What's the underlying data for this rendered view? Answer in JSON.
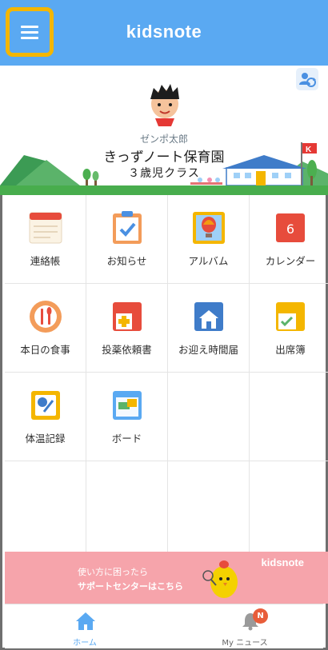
{
  "header": {
    "brand": "kidsnote",
    "color": "#5aa9f2",
    "menu_icon": "hamburger-menu-icon",
    "highlight": "#f4b600"
  },
  "profile": {
    "user_name": "ゼンポ太郎",
    "school": "きっずノート保育園",
    "class": "３歳児クラス",
    "switch_icon": "switch-account-icon"
  },
  "menu": {
    "items": [
      {
        "label": "連絡帳",
        "icon": "notebook-icon"
      },
      {
        "label": "お知らせ",
        "icon": "notice-clipboard-icon"
      },
      {
        "label": "アルバム",
        "icon": "album-balloon-icon"
      },
      {
        "label": "カレンダー",
        "icon": "calendar-icon",
        "value": "6"
      },
      {
        "label": "本日の食事",
        "icon": "meal-icon"
      },
      {
        "label": "投薬依頼書",
        "icon": "medicine-request-icon"
      },
      {
        "label": "お迎え時間届",
        "icon": "pickup-house-icon"
      },
      {
        "label": "出席簿",
        "icon": "attendance-icon"
      },
      {
        "label": "体温記録",
        "icon": "thermometer-icon"
      },
      {
        "label": "ボード",
        "icon": "board-icon"
      }
    ]
  },
  "banner": {
    "line1": "使い方に困ったら",
    "line2": "サポートセンターはこちら",
    "brand": "kidsnote",
    "color": "#f6a4ab"
  },
  "tabbar": {
    "home_label": "ホーム",
    "news_label": "My ニュース",
    "news_badge": "N",
    "active_color": "#5aa9f2"
  }
}
